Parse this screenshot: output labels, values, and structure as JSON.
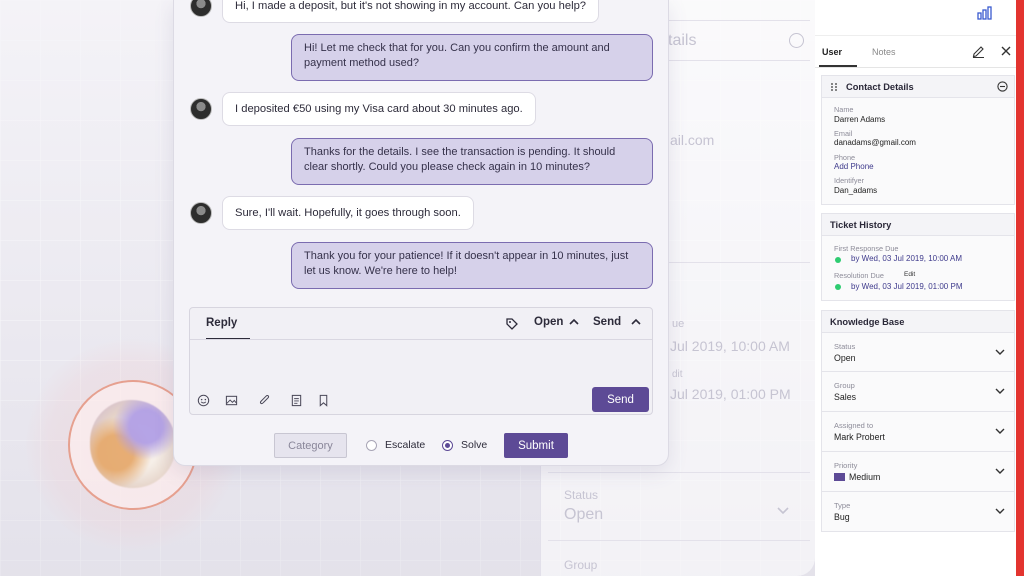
{
  "chat": {
    "messages": [
      {
        "from": "customer",
        "text": "Hi, I made a deposit, but it's not showing in my account. Can you help?"
      },
      {
        "from": "agent",
        "text": "Hi! Let me check that for you. Can you confirm the amount and payment method used?"
      },
      {
        "from": "customer",
        "text": "I deposited €50 using my Visa card about 30 minutes ago."
      },
      {
        "from": "agent",
        "text": "Thanks for the details. I see the transaction is pending. It should clear shortly. Could you please check again in 10 minutes?"
      },
      {
        "from": "customer",
        "text": "Sure, I'll wait. Hopefully, it goes through soon."
      },
      {
        "from": "agent",
        "text": "Thank you for your patience! If it doesn't appear in 10 minutes, just let us know. We're here to help!"
      }
    ]
  },
  "reply": {
    "tab_label": "Reply",
    "status_label": "Open",
    "send_menu_label": "Send",
    "send_button": "Send"
  },
  "actions": {
    "category_button": "Category",
    "escalate_label": "Escalate",
    "solve_label": "Solve",
    "selected_option": "Solve",
    "submit_button": "Submit"
  },
  "background_panel": {
    "title_fragment": "tails",
    "email_fragment": "ail.com",
    "due_fragment": "ue",
    "first_date_fragment": "Jul 2019, 10:00 AM",
    "edit_fragment": "dit",
    "second_date_fragment": "Jul 2019, 01:00 PM",
    "status_label": "Status",
    "status_value": "Open",
    "group_label": "Group"
  },
  "side_panel": {
    "tabs": [
      "User",
      "Notes"
    ],
    "active_tab": "User",
    "contact": {
      "title": "Contact Details",
      "name_label": "Name",
      "name": "Darren Adams",
      "email_label": "Email",
      "email": "danadams@gmail.com",
      "phone_label": "Phone",
      "phone_action": "Add Phone",
      "identifier_label": "Identifyer",
      "identifier": "Dan_adams"
    },
    "ticket_history": {
      "title": "Ticket History",
      "first_response_label": "First Response Due",
      "first_response_value": "by Wed, 03 Jul 2019, 10:00 AM",
      "resolution_label": "Resolution Due",
      "resolution_edit": "Edit",
      "resolution_value": "by Wed, 03 Jul 2019, 01:00 PM",
      "status_dot_color": "#2ecc71"
    },
    "knowledge_base": {
      "title": "Knowledge Base",
      "fields": [
        {
          "label": "Status",
          "value": "Open"
        },
        {
          "label": "Group",
          "value": "Sales"
        },
        {
          "label": "Assigned to",
          "value": "Mark Probert"
        },
        {
          "label": "Priority",
          "value": "Medium"
        },
        {
          "label": "Type",
          "value": "Bug"
        }
      ]
    }
  },
  "colors": {
    "accent": "#5d4a96",
    "agent_bubble": "#d6d1ea",
    "alert_bar": "#e3342f"
  }
}
